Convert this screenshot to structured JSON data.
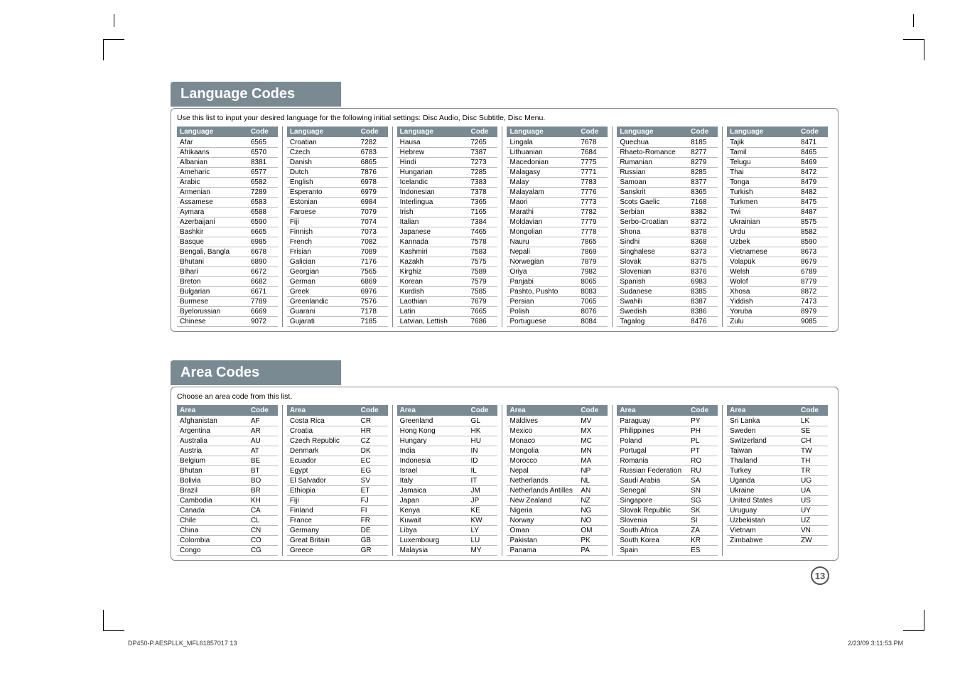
{
  "page_number": "13",
  "footer_left": "DP450-P.AESPLLK_MFL61857017   13",
  "footer_right": "2/23/09   3:11:53 PM",
  "lang_section": {
    "title": "Language Codes",
    "intro": "Use this list to input your desired language for the following initial settings: Disc Audio, Disc Subtitle, Disc Menu.",
    "head1": "Language",
    "head2": "Code",
    "columns": [
      [
        [
          "Afar",
          "6565"
        ],
        [
          "Afrikaans",
          "6570"
        ],
        [
          "Albanian",
          "8381"
        ],
        [
          "Ameharic",
          "6577"
        ],
        [
          "Arabic",
          "6582"
        ],
        [
          "Armenian",
          "7289"
        ],
        [
          "Assamese",
          "6583"
        ],
        [
          "Aymara",
          "6588"
        ],
        [
          "Azerbaijani",
          "6590"
        ],
        [
          "Bashkir",
          "6665"
        ],
        [
          "Basque",
          "6985"
        ],
        [
          "Bengali, Bangla",
          "6678"
        ],
        [
          "Bhutani",
          "6890"
        ],
        [
          "Bihari",
          "6672"
        ],
        [
          "Breton",
          "6682"
        ],
        [
          "Bulgarian",
          "6671"
        ],
        [
          "Burmese",
          "7789"
        ],
        [
          "Byelorussian",
          "6669"
        ],
        [
          "Chinese",
          "9072"
        ]
      ],
      [
        [
          "Croatian",
          "7282"
        ],
        [
          "Czech",
          "6783"
        ],
        [
          "Danish",
          "6865"
        ],
        [
          "Dutch",
          "7876"
        ],
        [
          "English",
          "6978"
        ],
        [
          "Esperanto",
          "6979"
        ],
        [
          "Estonian",
          "6984"
        ],
        [
          "Faroese",
          "7079"
        ],
        [
          "Fiji",
          "7074"
        ],
        [
          "Finnish",
          "7073"
        ],
        [
          "French",
          "7082"
        ],
        [
          "Frisian",
          "7089"
        ],
        [
          "Galician",
          "7176"
        ],
        [
          "Georgian",
          "7565"
        ],
        [
          "German",
          "6869"
        ],
        [
          "Greek",
          "6976"
        ],
        [
          "Greenlandic",
          "7576"
        ],
        [
          "Guarani",
          "7178"
        ],
        [
          "Gujarati",
          "7185"
        ]
      ],
      [
        [
          "Hausa",
          "7265"
        ],
        [
          "Hebrew",
          "7387"
        ],
        [
          "Hindi",
          "7273"
        ],
        [
          "Hungarian",
          "7285"
        ],
        [
          "Icelandic",
          "7383"
        ],
        [
          "Indonesian",
          "7378"
        ],
        [
          "Interlingua",
          "7365"
        ],
        [
          "Irish",
          "7165"
        ],
        [
          "Italian",
          "7384"
        ],
        [
          "Japanese",
          "7465"
        ],
        [
          "Kannada",
          "7578"
        ],
        [
          "Kashmiri",
          "7583"
        ],
        [
          "Kazakh",
          "7575"
        ],
        [
          "Kirghiz",
          "7589"
        ],
        [
          "Korean",
          "7579"
        ],
        [
          "Kurdish",
          "7585"
        ],
        [
          "Laothian",
          "7679"
        ],
        [
          "Latin",
          "7665"
        ],
        [
          "Latvian, Lettish",
          "7686"
        ]
      ],
      [
        [
          "Lingala",
          "7678"
        ],
        [
          "Lithuanian",
          "7684"
        ],
        [
          "Macedonian",
          "7775"
        ],
        [
          "Malagasy",
          "7771"
        ],
        [
          "Malay",
          "7783"
        ],
        [
          "Malayalam",
          "7776"
        ],
        [
          "Maori",
          "7773"
        ],
        [
          "Marathi",
          "7782"
        ],
        [
          "Moldavian",
          "7779"
        ],
        [
          "Mongolian",
          "7778"
        ],
        [
          "Nauru",
          "7865"
        ],
        [
          "Nepali",
          "7869"
        ],
        [
          "Norwegian",
          "7879"
        ],
        [
          "Oriya",
          "7982"
        ],
        [
          "Panjabi",
          "8065"
        ],
        [
          "Pashto, Pushto",
          "8083"
        ],
        [
          "Persian",
          "7065"
        ],
        [
          "Polish",
          "8076"
        ],
        [
          "Portuguese",
          "8084"
        ]
      ],
      [
        [
          "Quechua",
          "8185"
        ],
        [
          "Rhaeto-Romance",
          "8277"
        ],
        [
          "Rumanian",
          "8279"
        ],
        [
          "Russian",
          "8285"
        ],
        [
          "Samoan",
          "8377"
        ],
        [
          "Sanskrit",
          "8365"
        ],
        [
          "Scots Gaelic",
          "7168"
        ],
        [
          "Serbian",
          "8382"
        ],
        [
          "Serbo-Croatian",
          "8372"
        ],
        [
          "Shona",
          "8378"
        ],
        [
          "Sindhi",
          "8368"
        ],
        [
          "Singhalese",
          "8373"
        ],
        [
          "Slovak",
          "8375"
        ],
        [
          "Slovenian",
          "8376"
        ],
        [
          "Spanish",
          "6983"
        ],
        [
          "Sudanese",
          "8385"
        ],
        [
          "Swahili",
          "8387"
        ],
        [
          "Swedish",
          "8386"
        ],
        [
          "Tagalog",
          "8476"
        ]
      ],
      [
        [
          "Tajik",
          "8471"
        ],
        [
          "Tamil",
          "8465"
        ],
        [
          "Telugu",
          "8469"
        ],
        [
          "Thai",
          "8472"
        ],
        [
          "Tonga",
          "8479"
        ],
        [
          "Turkish",
          "8482"
        ],
        [
          "Turkmen",
          "8475"
        ],
        [
          "Twi",
          "8487"
        ],
        [
          "Ukrainian",
          "8575"
        ],
        [
          "Urdu",
          "8582"
        ],
        [
          "Uzbek",
          "8590"
        ],
        [
          "Vietnamese",
          "8673"
        ],
        [
          "Volapük",
          "8679"
        ],
        [
          "Welsh",
          "6789"
        ],
        [
          "Wolof",
          "8779"
        ],
        [
          "Xhosa",
          "8872"
        ],
        [
          "Yiddish",
          "7473"
        ],
        [
          "Yoruba",
          "8979"
        ],
        [
          "Zulu",
          "9085"
        ]
      ]
    ]
  },
  "area_section": {
    "title": "Area Codes",
    "intro": "Choose an area code from this list.",
    "head1": "Area",
    "head2": "Code",
    "columns": [
      [
        [
          "Afghanistan",
          "AF"
        ],
        [
          "Argentina",
          "AR"
        ],
        [
          "Australia",
          "AU"
        ],
        [
          "Austria",
          "AT"
        ],
        [
          "Belgium",
          "BE"
        ],
        [
          "Bhutan",
          "BT"
        ],
        [
          "Bolivia",
          "BO"
        ],
        [
          "Brazil",
          "BR"
        ],
        [
          "Cambodia",
          "KH"
        ],
        [
          "Canada",
          "CA"
        ],
        [
          "Chile",
          "CL"
        ],
        [
          "China",
          "CN"
        ],
        [
          "Colombia",
          "CO"
        ],
        [
          "Congo",
          "CG"
        ]
      ],
      [
        [
          "Costa Rica",
          "CR"
        ],
        [
          "Croatia",
          "HR"
        ],
        [
          "Czech Republic",
          "CZ"
        ],
        [
          "Denmark",
          "DK"
        ],
        [
          "Ecuador",
          "EC"
        ],
        [
          "Egypt",
          "EG"
        ],
        [
          "El Salvador",
          "SV"
        ],
        [
          "Ethiopia",
          "ET"
        ],
        [
          "Fiji",
          "FJ"
        ],
        [
          "Finland",
          "FI"
        ],
        [
          "France",
          "FR"
        ],
        [
          "Germany",
          "DE"
        ],
        [
          "Great Britain",
          "GB"
        ],
        [
          "Greece",
          "GR"
        ]
      ],
      [
        [
          "Greenland",
          "GL"
        ],
        [
          "Hong Kong",
          "HK"
        ],
        [
          "Hungary",
          "HU"
        ],
        [
          "India",
          "IN"
        ],
        [
          "Indonesia",
          "ID"
        ],
        [
          "Israel",
          "IL"
        ],
        [
          "Italy",
          "IT"
        ],
        [
          "Jamaica",
          "JM"
        ],
        [
          "Japan",
          "JP"
        ],
        [
          "Kenya",
          "KE"
        ],
        [
          "Kuwait",
          "KW"
        ],
        [
          "Libya",
          "LY"
        ],
        [
          "Luxembourg",
          "LU"
        ],
        [
          "Malaysia",
          "MY"
        ]
      ],
      [
        [
          "Maldives",
          "MV"
        ],
        [
          "Mexico",
          "MX"
        ],
        [
          "Monaco",
          "MC"
        ],
        [
          "Mongolia",
          "MN"
        ],
        [
          "Morocco",
          "MA"
        ],
        [
          "Nepal",
          "NP"
        ],
        [
          "Netherlands",
          "NL"
        ],
        [
          "Netherlands Antilles",
          "AN"
        ],
        [
          "New Zealand",
          "NZ"
        ],
        [
          "Nigeria",
          "NG"
        ],
        [
          "Norway",
          "NO"
        ],
        [
          "Oman",
          "OM"
        ],
        [
          "Pakistan",
          "PK"
        ],
        [
          "Panama",
          "PA"
        ]
      ],
      [
        [
          "Paraguay",
          "PY"
        ],
        [
          "Philippines",
          "PH"
        ],
        [
          "Poland",
          "PL"
        ],
        [
          "Portugal",
          "PT"
        ],
        [
          "Romania",
          "RO"
        ],
        [
          "Russian Federation",
          "RU"
        ],
        [
          "Saudi Arabia",
          "SA"
        ],
        [
          "Senegal",
          "SN"
        ],
        [
          "Singapore",
          "SG"
        ],
        [
          "Slovak Republic",
          "SK"
        ],
        [
          "Slovenia",
          "SI"
        ],
        [
          "South Africa",
          "ZA"
        ],
        [
          "South Korea",
          "KR"
        ],
        [
          "Spain",
          "ES"
        ]
      ],
      [
        [
          "Sri Lanka",
          "LK"
        ],
        [
          "Sweden",
          "SE"
        ],
        [
          "Switzerland",
          "CH"
        ],
        [
          "Taiwan",
          "TW"
        ],
        [
          "Thailand",
          "TH"
        ],
        [
          "Turkey",
          "TR"
        ],
        [
          "Uganda",
          "UG"
        ],
        [
          "Ukraine",
          "UA"
        ],
        [
          "United States",
          "US"
        ],
        [
          "Uruguay",
          "UY"
        ],
        [
          "Uzbekistan",
          "UZ"
        ],
        [
          "Vietnam",
          "VN"
        ],
        [
          "Zimbabwe",
          "ZW"
        ]
      ]
    ]
  }
}
